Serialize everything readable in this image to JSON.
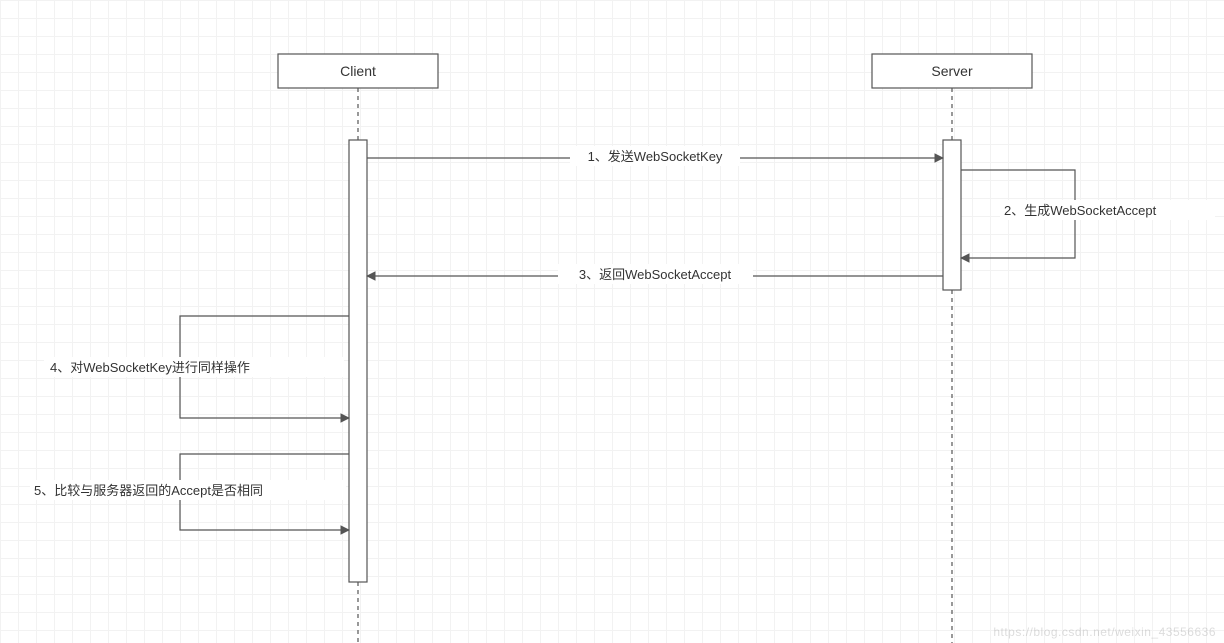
{
  "diagram": {
    "type": "sequence",
    "participants": {
      "client": "Client",
      "server": "Server"
    },
    "messages": {
      "m1": "1、发送WebSocketKey",
      "m2": "2、生成WebSocketAccept",
      "m3": "3、返回WebSocketAccept",
      "m4": "4、对WebSocketKey进行同样操作",
      "m5": "5、比较与服务器返回的Accept是否相同"
    }
  },
  "watermark": "https://blog.csdn.net/weixin_43556636"
}
